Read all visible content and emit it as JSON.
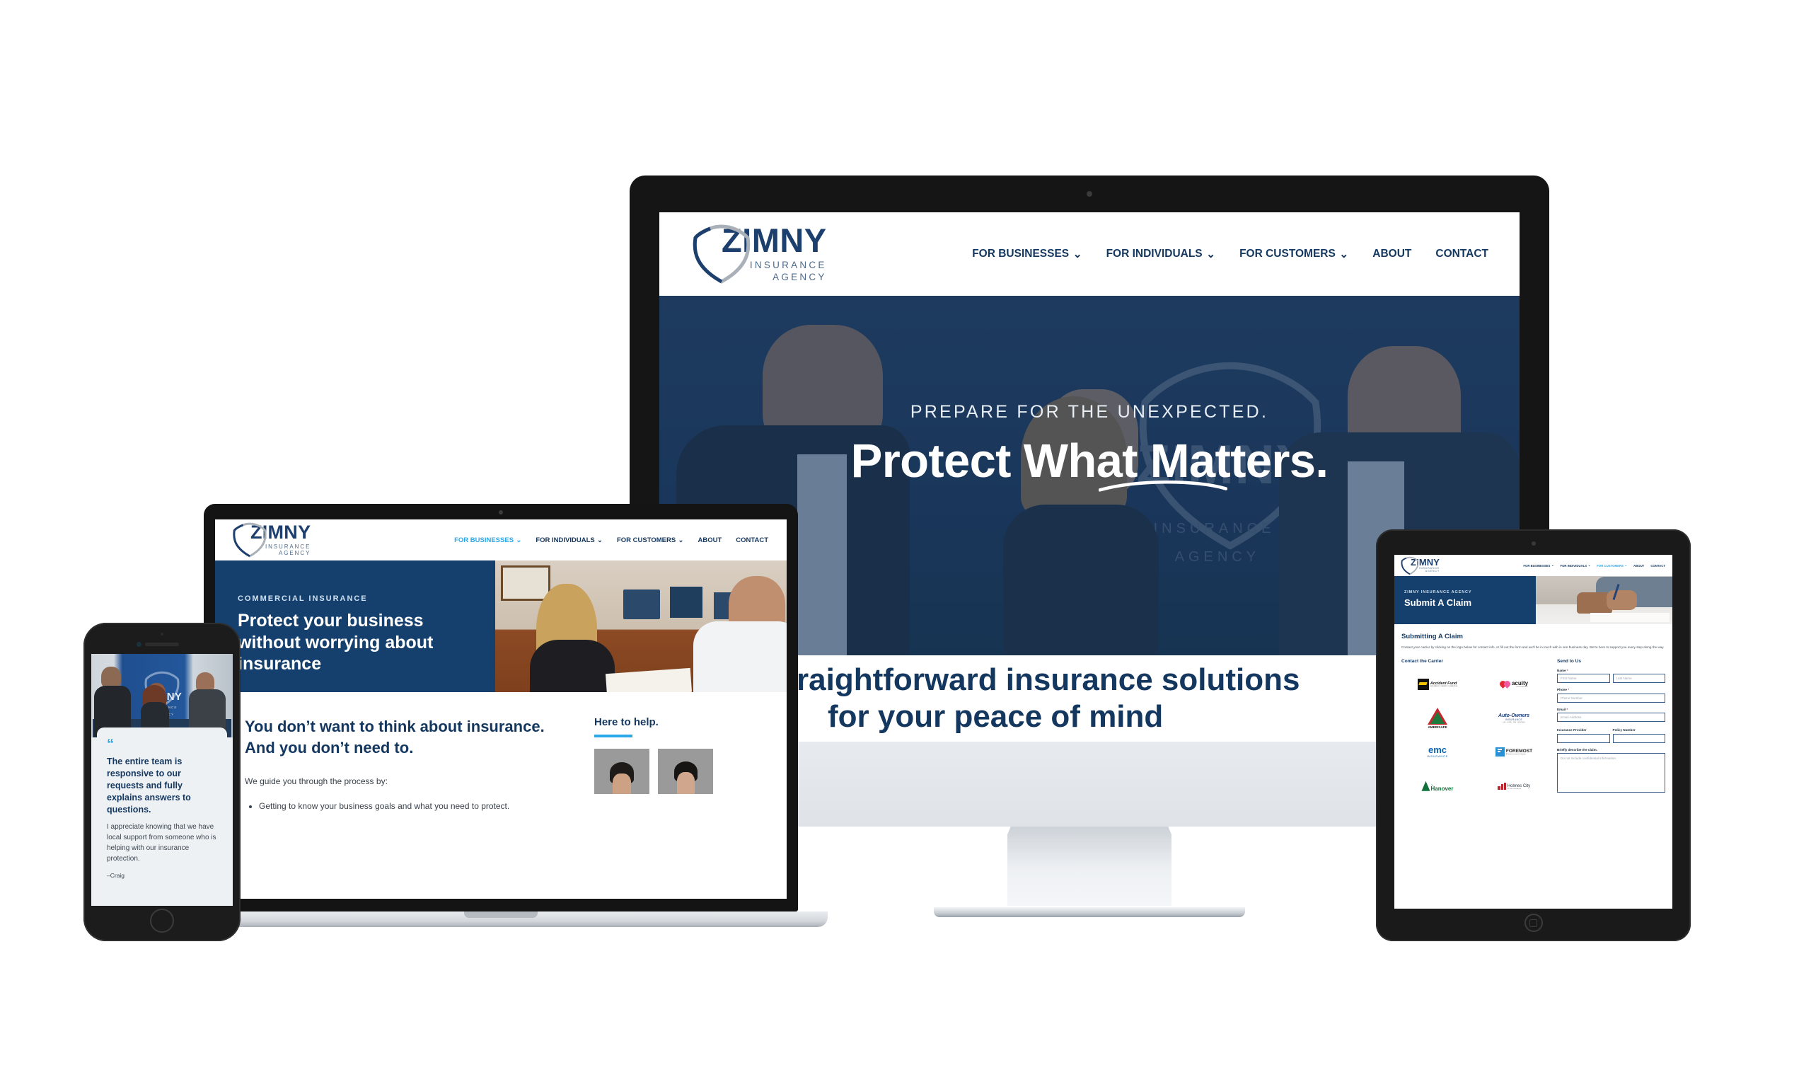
{
  "brand": {
    "name": "ZIMNY",
    "line1": "INSURANCE",
    "line2": "AGENCY",
    "navy": "#14375f",
    "deep_navy": "#15406d",
    "cyan": "#2aa8e8",
    "shield_gray": "#a9b0b8"
  },
  "desktop": {
    "nav": [
      {
        "label": "FOR BUSINESSES",
        "caret": "⌄",
        "active": false
      },
      {
        "label": "FOR INDIVIDUALS",
        "caret": "⌄",
        "active": false
      },
      {
        "label": "FOR CUSTOMERS",
        "caret": "⌄",
        "active": false
      },
      {
        "label": "ABOUT",
        "caret": "",
        "active": false
      },
      {
        "label": "CONTACT",
        "caret": "",
        "active": false
      }
    ],
    "hero": {
      "kicker": "PREPARE FOR THE UNEXPECTED.",
      "title": "Protect What Matters."
    },
    "solutions": {
      "line1": "Straightforward insurance solutions",
      "line2": "for your peace of mind"
    }
  },
  "laptop": {
    "nav": [
      {
        "label": "FOR BUSINESSES",
        "caret": "⌄",
        "active": true
      },
      {
        "label": "FOR INDIVIDUALS",
        "caret": "⌄",
        "active": false
      },
      {
        "label": "FOR CUSTOMERS",
        "caret": "⌄",
        "active": false
      },
      {
        "label": "ABOUT",
        "caret": "",
        "active": false
      },
      {
        "label": "CONTACT",
        "caret": "",
        "active": false
      }
    ],
    "hero": {
      "kicker": "COMMERCIAL INSURANCE",
      "title": "Protect your business without worrying about insurance"
    },
    "body": {
      "heading_line1": "You don’t want to think about insurance.",
      "heading_line2": "And you don’t need to.",
      "intro": "We guide you through the process by:",
      "bullets": [
        "Getting to know your business goals and what you need to protect."
      ],
      "aside_heading": "Here to help."
    }
  },
  "phone": {
    "testimonial": {
      "quote_mark": "“",
      "headline": "The entire team is responsive to our requests and fully explains answers to questions.",
      "body": "I appreciate knowing that we have local support from someone who is helping with our insurance protection.",
      "attribution": "–Craig"
    }
  },
  "tablet": {
    "nav": [
      {
        "label": "FOR BUSINESSES",
        "caret": "⌄",
        "active": false
      },
      {
        "label": "FOR INDIVIDUALS",
        "caret": "⌄",
        "active": false
      },
      {
        "label": "FOR CUSTOMERS",
        "caret": "⌄",
        "active": true
      },
      {
        "label": "ABOUT",
        "caret": "",
        "active": false
      },
      {
        "label": "CONTACT",
        "caret": "",
        "active": false
      }
    ],
    "hero": {
      "kicker": "ZIMNY INSURANCE AGENCY",
      "title": "Submit A Claim"
    },
    "body": {
      "heading": "Submitting A Claim",
      "paragraph": "Contact your carrier by clicking on the logo below for contact info, or fill out the form and we'll be in touch with in one business day. We're here to support you every step along the way.",
      "carriers_heading": "Contact the Carrier",
      "form_heading": "Send to Us"
    },
    "carriers": [
      {
        "name": "Accident Fund",
        "sub": "INSURANCE COMPANY OF AMERICA"
      },
      {
        "name": "acuity",
        "sub": "INSURANCE"
      },
      {
        "name": "AMERISAFE",
        "sub": ""
      },
      {
        "name": "Auto-Owners",
        "sub": "INSURANCE"
      },
      {
        "name": "emc",
        "sub": "INSURANCE"
      },
      {
        "name": "FOREMOST",
        "sub": "A Farmers Insurance Company"
      },
      {
        "name": "Hanover",
        "sub": "The"
      },
      {
        "name": "Holmes City",
        "sub": "MUTUAL INSURANCE"
      }
    ],
    "form": {
      "name_label": "Name",
      "name_required": "*",
      "first_name_placeholder": "First Name",
      "last_name_placeholder": "Last Name",
      "phone_label": "Phone",
      "phone_required": "*",
      "phone_placeholder": "Phone Number",
      "email_label": "Email",
      "email_required": "*",
      "email_placeholder": "Email Address",
      "provider_label": "Insurance Provider",
      "policy_label": "Policy Number",
      "describe_label": "Briefly describe the claim.",
      "describe_placeholder": "Do not include confidential information."
    }
  }
}
